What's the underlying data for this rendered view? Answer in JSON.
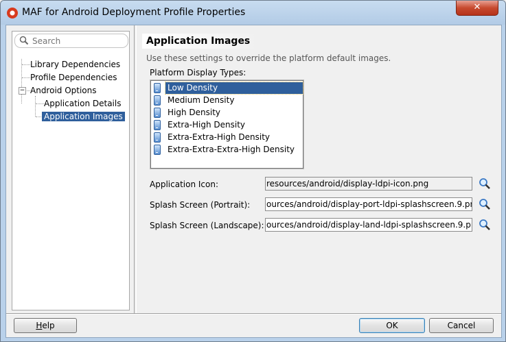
{
  "window": {
    "title": "MAF for Android Deployment Profile Properties",
    "close_glyph": "✕"
  },
  "search": {
    "placeholder": "Search"
  },
  "nav": {
    "items": [
      {
        "label": "Library Dependencies"
      },
      {
        "label": "Profile Dependencies"
      },
      {
        "label": "Android Options",
        "expanded": true
      },
      {
        "label": "Application Details"
      },
      {
        "label": "Application Images",
        "selected": true
      }
    ]
  },
  "page": {
    "title": "Application Images",
    "description": "Use these settings to override the platform default images.",
    "types_label": "Platform Display Types:",
    "display_types": [
      {
        "label": "Low Density",
        "selected": true
      },
      {
        "label": "Medium Density"
      },
      {
        "label": "High Density"
      },
      {
        "label": "Extra-High Density"
      },
      {
        "label": "Extra-Extra-High Density"
      },
      {
        "label": "Extra-Extra-Extra-High Density"
      }
    ],
    "fields": [
      {
        "label": "Application Icon:",
        "value": "resources/android/display-ldpi-icon.png"
      },
      {
        "label": "Splash Screen (Portrait):",
        "value": "ources/android/display-port-ldpi-splashscreen.9.png"
      },
      {
        "label": "Splash Screen (Landscape):",
        "value": "ources/android/display-land-ldpi-splashscreen.9.png"
      }
    ]
  },
  "buttons": {
    "help": {
      "mnemonic": "H",
      "rest": "elp"
    },
    "ok": "OK",
    "cancel": "Cancel"
  },
  "colors": {
    "selection": "#2f5f9c",
    "close_button": "#c74a2f"
  }
}
